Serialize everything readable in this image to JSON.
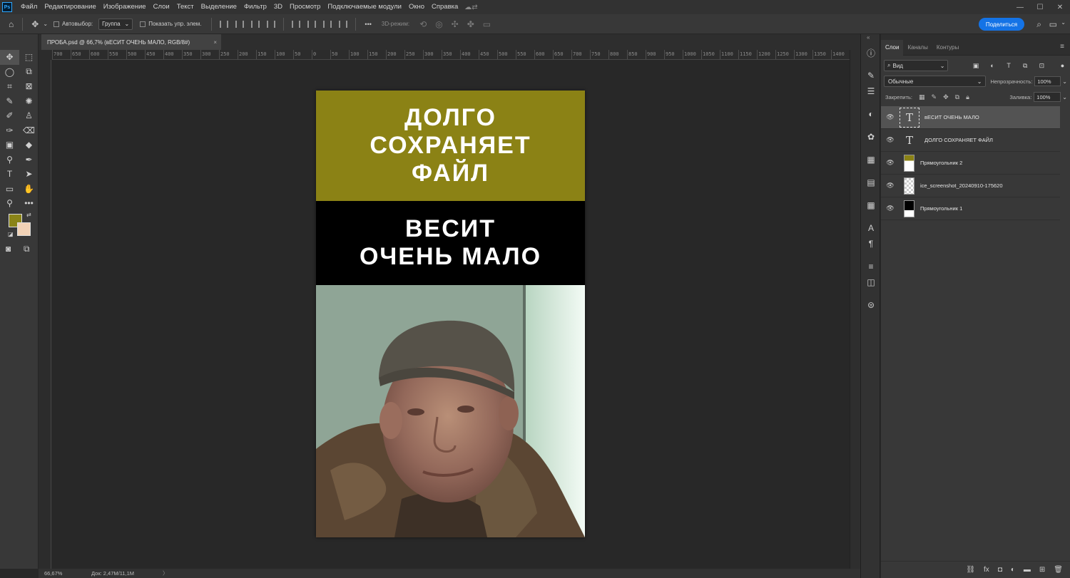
{
  "app": {
    "logo_text": "Ps",
    "menu": [
      "Файл",
      "Редактирование",
      "Изображение",
      "Слои",
      "Текст",
      "Выделение",
      "Фильтр",
      "3D",
      "Просмотр",
      "Подключаемые модули",
      "Окно",
      "Справка"
    ],
    "window_controls": [
      "—",
      "☐",
      "✕"
    ]
  },
  "options_bar": {
    "auto_select_label": "Автовыбор:",
    "auto_select_value": "Группа",
    "show_transform_label": "Показать упр. элем.",
    "more_label": "•••",
    "mode_3d_label": "3D-режим:",
    "share_label": "Поделиться"
  },
  "document": {
    "tab_title": "ПРОБА.psd @ 66,7% (вЕСИТ ОЧЕНЬ МАЛО, RGB/8#)",
    "close_glyph": "×",
    "ruler_labels": [
      "700",
      "650",
      "600",
      "550",
      "500",
      "450",
      "400",
      "350",
      "300",
      "250",
      "200",
      "150",
      "100",
      "50",
      "0",
      "50",
      "100",
      "150",
      "200",
      "250",
      "300",
      "350",
      "400",
      "450",
      "500",
      "550",
      "600",
      "650",
      "700",
      "750",
      "800",
      "850",
      "900",
      "950",
      "1000",
      "1050",
      "1100",
      "1150",
      "1200",
      "1250",
      "1300",
      "1350",
      "1400"
    ],
    "text_top": "ДОЛГО\nСОХРАНЯЕТ\nФАЙЛ",
    "text_middle": "ВЕСИТ\nОЧЕНЬ МАЛО",
    "band_top_color": "#8b8215",
    "band_middle_color": "#000000"
  },
  "status": {
    "zoom": "66,67%",
    "doc_size": "Док: 2,47M/11,1M",
    "arrow": "〉"
  },
  "colors": {
    "foreground": "#8a8417",
    "background": "#f1d2b6",
    "accent": "#1473e6"
  },
  "layers_panel": {
    "tabs": [
      "Слои",
      "Каналы",
      "Контуры"
    ],
    "active_tab": "Слои",
    "filter_label": "Вид",
    "blend_mode": "Обычные",
    "opacity_label": "Непрозрачность:",
    "opacity_value": "100%",
    "lock_label": "Закрепить:",
    "fill_label": "Заливка:",
    "fill_value": "100%",
    "layers": [
      {
        "name": "вЕСИТ ОЧЕНЬ МАЛО",
        "kind": "text",
        "selected": true
      },
      {
        "name": "ДОЛГО СОХРАНЯЕТ ФАЙЛ",
        "kind": "text",
        "selected": false
      },
      {
        "name": "Прямоугольник 2",
        "kind": "shape",
        "thumb_color": "#8b8215",
        "selected": false
      },
      {
        "name": "ice_screenshot_20240910-175620",
        "kind": "image",
        "selected": false
      },
      {
        "name": "Прямоугольник 1",
        "kind": "shape",
        "thumb_color": "#000000",
        "selected": false
      }
    ]
  }
}
